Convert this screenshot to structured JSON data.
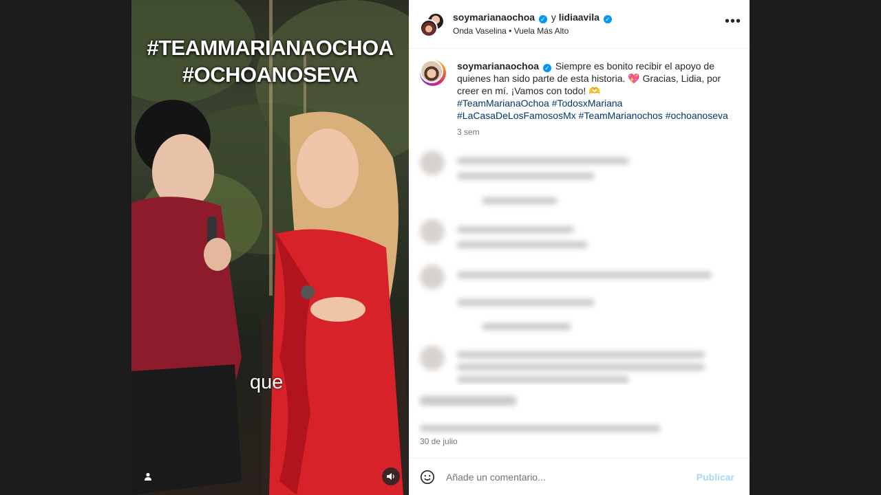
{
  "header": {
    "username_1": "soymarianaochoa",
    "joiner": "y",
    "username_2": "lidiaavila",
    "music": "Onda Vaselina • Vuela Más Alto",
    "more_icon": "more-horizontal-icon"
  },
  "media": {
    "overlay_line_1": "#TEAMMARIANAOCHOA",
    "overlay_line_2": "#OCHOANOSEVA",
    "subtitle": "que"
  },
  "caption": {
    "username": "soymarianaochoa",
    "text": "Siempre es bonito recibir el apoyo de quienes han sido parte de esta historia. 💖 Gracias, Lidia, por creer en mí. ¡Vamos con todo! 🫶",
    "hashtags": "#TeamMarianaOchoa #TodosxMariana #LaCasaDeLosFamososMx #TeamMarianochos #ochoanoseva",
    "time": "3 sem"
  },
  "footer": {
    "date": "30 de julio",
    "comment_placeholder": "Añade un comentario...",
    "publish_label": "Publicar"
  },
  "colors": {
    "link": "#00376b",
    "verified": "#0095f6",
    "publish_disabled": "#a8d6f5"
  }
}
